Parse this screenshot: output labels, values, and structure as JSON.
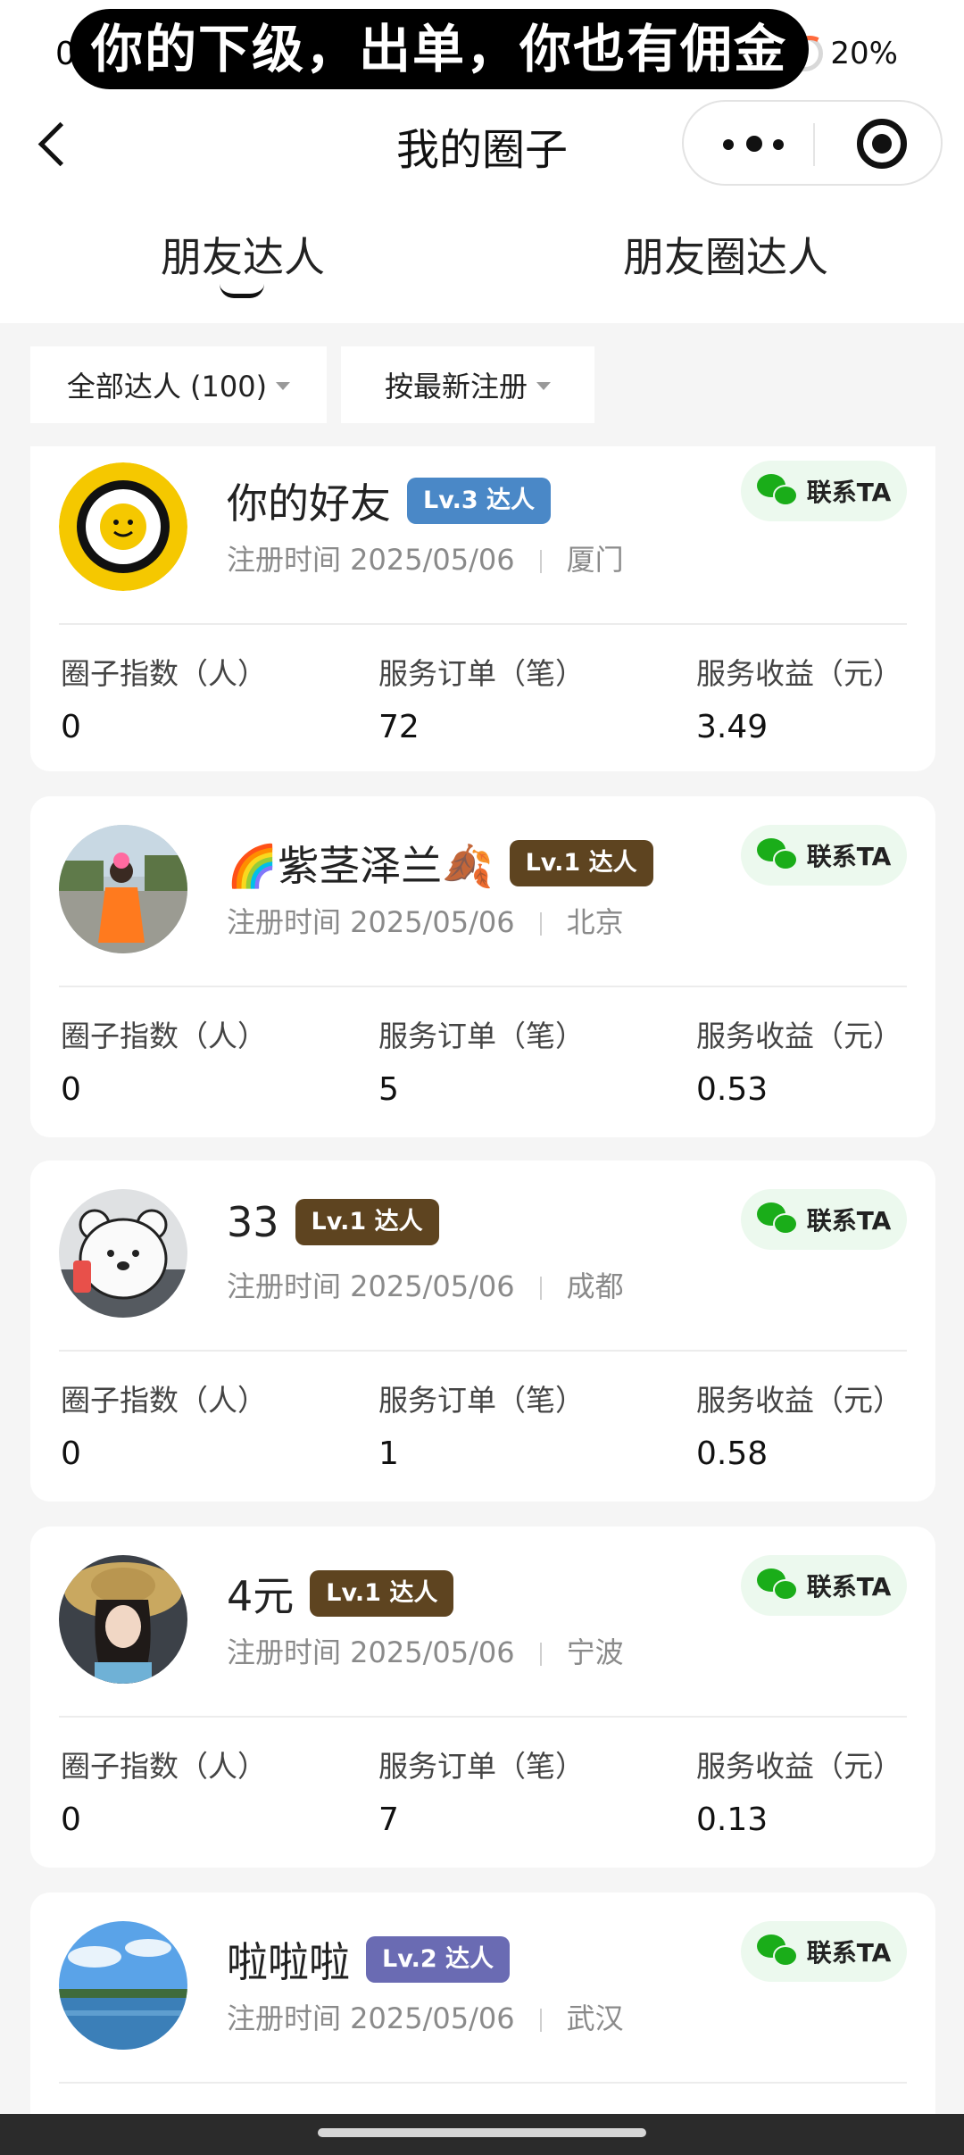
{
  "status_bar": {
    "left_text": "0",
    "battery": "20%"
  },
  "caption": "你的下级，出单，你也有佣金",
  "nav": {
    "title": "我的圈子"
  },
  "tabs": [
    {
      "label": "朋友达人",
      "active": true
    },
    {
      "label": "朋友圈达人",
      "active": false
    }
  ],
  "filters": [
    {
      "label": "全部达人 (100)"
    },
    {
      "label": "按最新注册"
    }
  ],
  "stat_labels": [
    "圈子指数（人）",
    "服务订单（笔）",
    "服务收益（元）"
  ],
  "contact_label": "联系TA",
  "cards": [
    {
      "name": "你的好友",
      "level": "Lv.3 达人",
      "level_color": "#4a88c7",
      "register": "注册时间 2025/05/06",
      "city": "厦门",
      "circle_index": "0",
      "orders": "72",
      "income": "3.49"
    },
    {
      "name": "🌈紫茎泽兰🍂",
      "level": "Lv.1 达人",
      "level_color": "#5e4420",
      "register": "注册时间 2025/05/06",
      "city": "北京",
      "circle_index": "0",
      "orders": "5",
      "income": "0.53"
    },
    {
      "name": "33",
      "level": "Lv.1 达人",
      "level_color": "#5e4420",
      "register": "注册时间 2025/05/06",
      "city": "成都",
      "circle_index": "0",
      "orders": "1",
      "income": "0.58"
    },
    {
      "name": "4元",
      "level": "Lv.1 达人",
      "level_color": "#5e4420",
      "register": "注册时间 2025/05/06",
      "city": "宁波",
      "circle_index": "0",
      "orders": "7",
      "income": "0.13"
    },
    {
      "name": "啦啦啦",
      "level": "Lv.2 达人",
      "level_color": "#6a6bb3",
      "register": "注册时间 2025/05/06",
      "city": "武汉"
    }
  ]
}
